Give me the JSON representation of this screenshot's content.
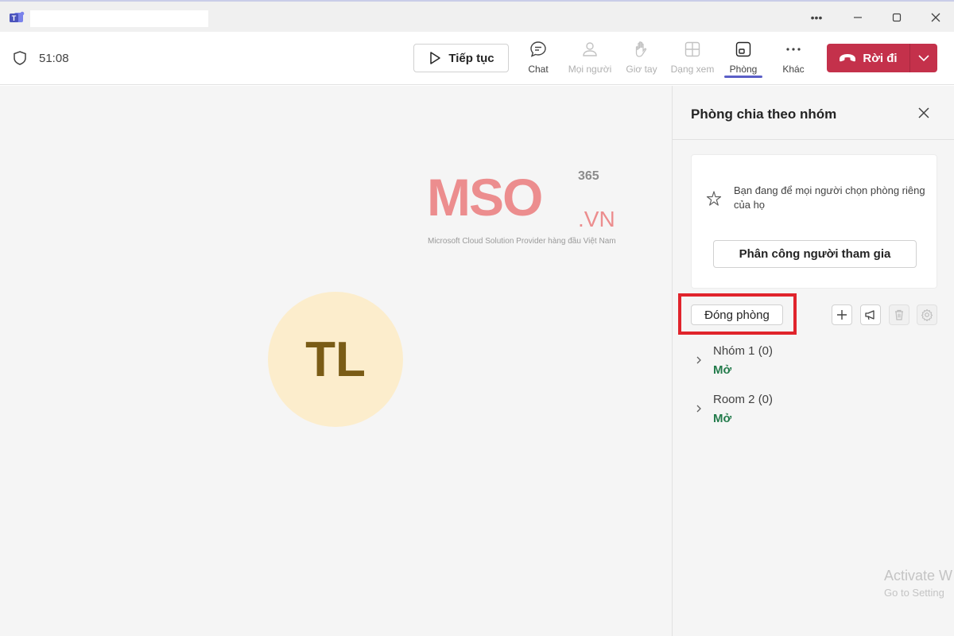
{
  "window": {
    "minimize_icon": "minimize-icon",
    "maximize_icon": "maximize-icon",
    "close_icon": "close-icon"
  },
  "toolbar": {
    "timer": "51:08",
    "resume_label": "Tiếp tục",
    "tools": [
      {
        "label": "Chat",
        "icon": "chat-icon",
        "enabled": true
      },
      {
        "label": "Mọi người",
        "icon": "people-icon",
        "enabled": false
      },
      {
        "label": "Giơ tay",
        "icon": "raise-hand-icon",
        "enabled": false
      },
      {
        "label": "Dạng xem",
        "icon": "view-icon",
        "enabled": false
      },
      {
        "label": "Phòng",
        "icon": "rooms-icon",
        "enabled": true,
        "active": true
      },
      {
        "label": "Khác",
        "icon": "more-icon",
        "enabled": true
      }
    ],
    "leave_label": "Rời đi"
  },
  "stage": {
    "avatar_initials": "TL"
  },
  "watermark": {
    "brand": "MSO",
    "suffix_365": "365",
    "suffix_vn": ".VN",
    "tagline": "Microsoft Cloud Solution Provider hàng đầu Việt Nam"
  },
  "panel": {
    "title": "Phòng chia theo nhóm",
    "info_text": "Bạn đang để mọi người chọn phòng riêng của họ",
    "assign_label": "Phân công người tham gia",
    "close_rooms_label": "Đóng phòng",
    "rooms": [
      {
        "name": "Nhóm 1  (0)",
        "status": "Mở"
      },
      {
        "name": "Room 2  (0)",
        "status": "Mở"
      }
    ]
  },
  "overlay": {
    "activate_title": "Activate W",
    "activate_sub": "Go to Setting"
  },
  "colors": {
    "accent": "#5b5fc7",
    "leave_red": "#c4314b",
    "status_green": "#237b4b",
    "highlight_red": "#e0242c"
  }
}
